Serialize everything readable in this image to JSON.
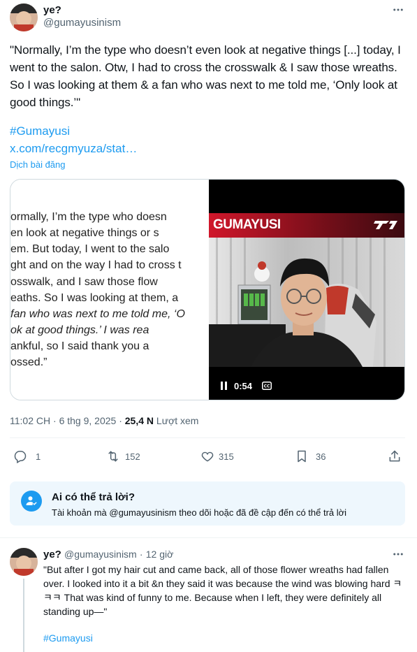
{
  "tweet": {
    "display_name": "ye?",
    "handle": "@gumayusinism",
    "text": "\"Normally, I’m the type who doesn’t even look at negative things [...] today, I went to the salon. Otw, I had to cross the crosswalk & I saw those wreaths. So I was looking at them & a fan who was next to me told me, ‘Only look at good things.’\"",
    "hashtag": "#Gumayusi",
    "link": "x.com/recgmyuza/stat…",
    "translate_label": "Dịch bài đăng",
    "time": "11:02 CH",
    "date": "6 thg 9, 2025",
    "views_count": "25,4 N",
    "views_label": "Lượt xem"
  },
  "media": {
    "quote_lines": [
      "ormally, I’m the type who doesn",
      "en look at negative things or s",
      "em. But today, I went to the salo",
      "ght and on the way I had to cross t",
      "osswalk, and I saw those flow",
      "eaths. So I was looking at them, a",
      "fan who was next to me told me, ‘O",
      "ok at good things.’ I was rea",
      "ankful, so I said thank you a",
      "ossed.”"
    ],
    "video_banner": "GUMAYUSI",
    "video_time": "0:54",
    "video_cc": "CC"
  },
  "actions": {
    "reply_count": "1",
    "retweet_count": "152",
    "like_count": "315",
    "bookmark_count": "36"
  },
  "who_can_reply": {
    "title": "Ai có thể trả lời?",
    "description": "Tài khoản mà @gumayusinism theo dõi hoặc đã đề cập đến có thể trả lời"
  },
  "reply": {
    "display_name": "ye?",
    "handle": "@gumayusinism",
    "separator": "·",
    "time_ago": "12 giờ",
    "text": "\"But after I got my hair cut and came back, all of those flower wreaths had fallen over. I looked into it a bit &n they said it was because the wind was blowing hard ㅋㅋㅋ That was kind of funny to me. Because when I left, they were definitely all standing up—\"",
    "hashtag": "#Gumayusi"
  },
  "colors": {
    "accent": "#1d9bf0",
    "secondary_text": "#536471",
    "reply_box_bg": "#eef7fd",
    "video_banner_red": "#b1142a"
  },
  "icons": [
    "more-icon",
    "reply-icon",
    "retweet-icon",
    "like-icon",
    "bookmark-icon",
    "share-icon",
    "user-check-icon",
    "pause-icon",
    "cc-icon",
    "t1-logo-icon"
  ]
}
